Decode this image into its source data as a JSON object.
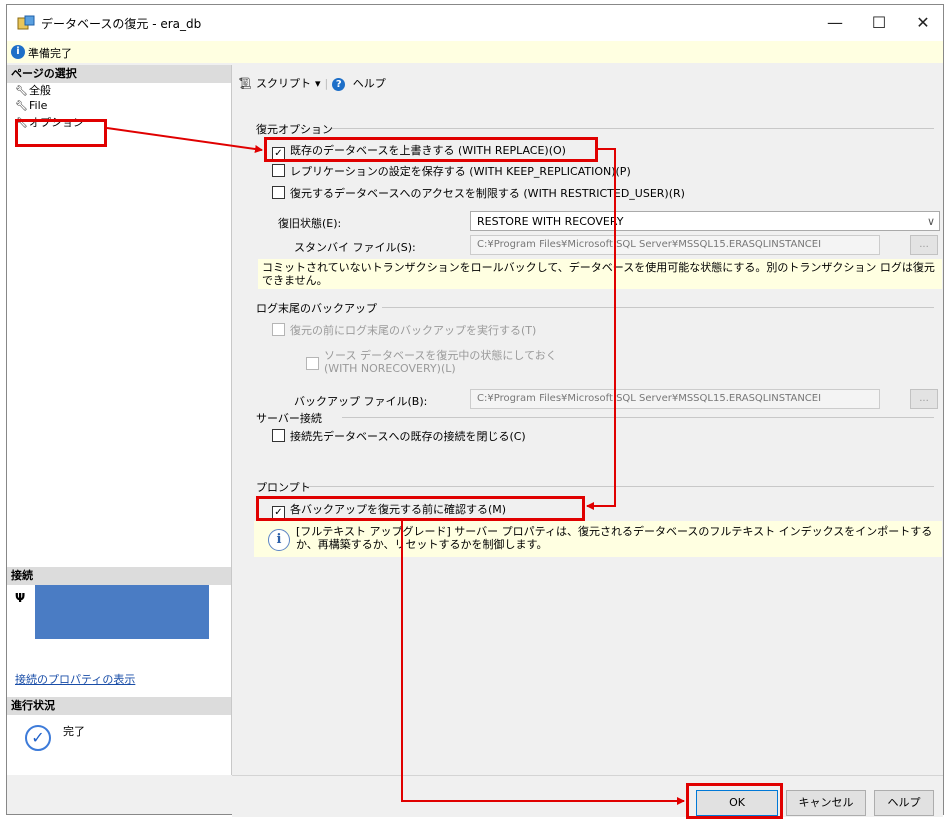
{
  "window": {
    "title": "データベースの復元 - era_db",
    "minimize": "—",
    "maximize": "☐",
    "close": "✕"
  },
  "status": {
    "text": "準備完了"
  },
  "sidebar": {
    "pages_header": "ページの選択",
    "items": [
      {
        "label": "全般"
      },
      {
        "label": "File"
      },
      {
        "label": "オプション"
      }
    ],
    "connection_header": "接続",
    "connection_link": "接続のプロパティの表示",
    "progress_header": "進行状況",
    "progress_status": "完了"
  },
  "toolbar": {
    "script": "スクリプト",
    "dropdown": "▾",
    "help": "ヘルプ"
  },
  "restore_options": {
    "header": "復元オプション",
    "overwrite": "既存のデータベースを上書きする (WITH REPLACE)(O)",
    "keep_replication": "レプリケーションの設定を保存する (WITH KEEP_REPLICATION)(P)",
    "restricted_user": "復元するデータベースへのアクセスを制限する (WITH RESTRICTED_USER)(R)",
    "recovery_state_label": "復旧状態(E):",
    "recovery_state_value": "RESTORE WITH RECOVERY",
    "standby_label": "スタンバイ ファイル(S):",
    "standby_value": "C:¥Program Files¥Microsoft SQL Server¥MSSQL15.ERASQLINSTANCEI",
    "browse": "...",
    "recovery_note": "コミットされていないトランザクションをロールバックして、データベースを使用可能な状態にする。別のトランザクション ログは復元できません。"
  },
  "tail_log": {
    "header": "ログ末尾のバックアップ",
    "take_tail": "復元の前にログ末尾のバックアップを実行する(T)",
    "leave_restoring_1": "ソース データベースを復元中の状態にしておく",
    "leave_restoring_2": "(WITH NORECOVERY)(L)",
    "backup_file_label": "バックアップ ファイル(B):",
    "backup_file_value": "C:¥Program Files¥Microsoft SQL Server¥MSSQL15.ERASQLINSTANCEI",
    "browse": "..."
  },
  "server_connection": {
    "header": "サーバー接続",
    "close_existing": "接続先データベースへの既存の接続を閉じる(C)"
  },
  "prompt": {
    "header": "プロンプト",
    "confirm_each": "各バックアップを復元する前に確認する(M)",
    "fulltext_note": "[フルテキスト アップグレード] サーバー プロパティは、復元されるデータベースのフルテキスト インデックスをインポートするか、再構築するか、リセットするかを制御します。"
  },
  "buttons": {
    "ok": "OK",
    "cancel": "キャンセル",
    "help": "ヘルプ"
  },
  "checks": {
    "checked": "✓"
  },
  "colors": {
    "highlight": "#e00000",
    "accent": "#0078d7",
    "connection_block": "#4a7cc4"
  }
}
